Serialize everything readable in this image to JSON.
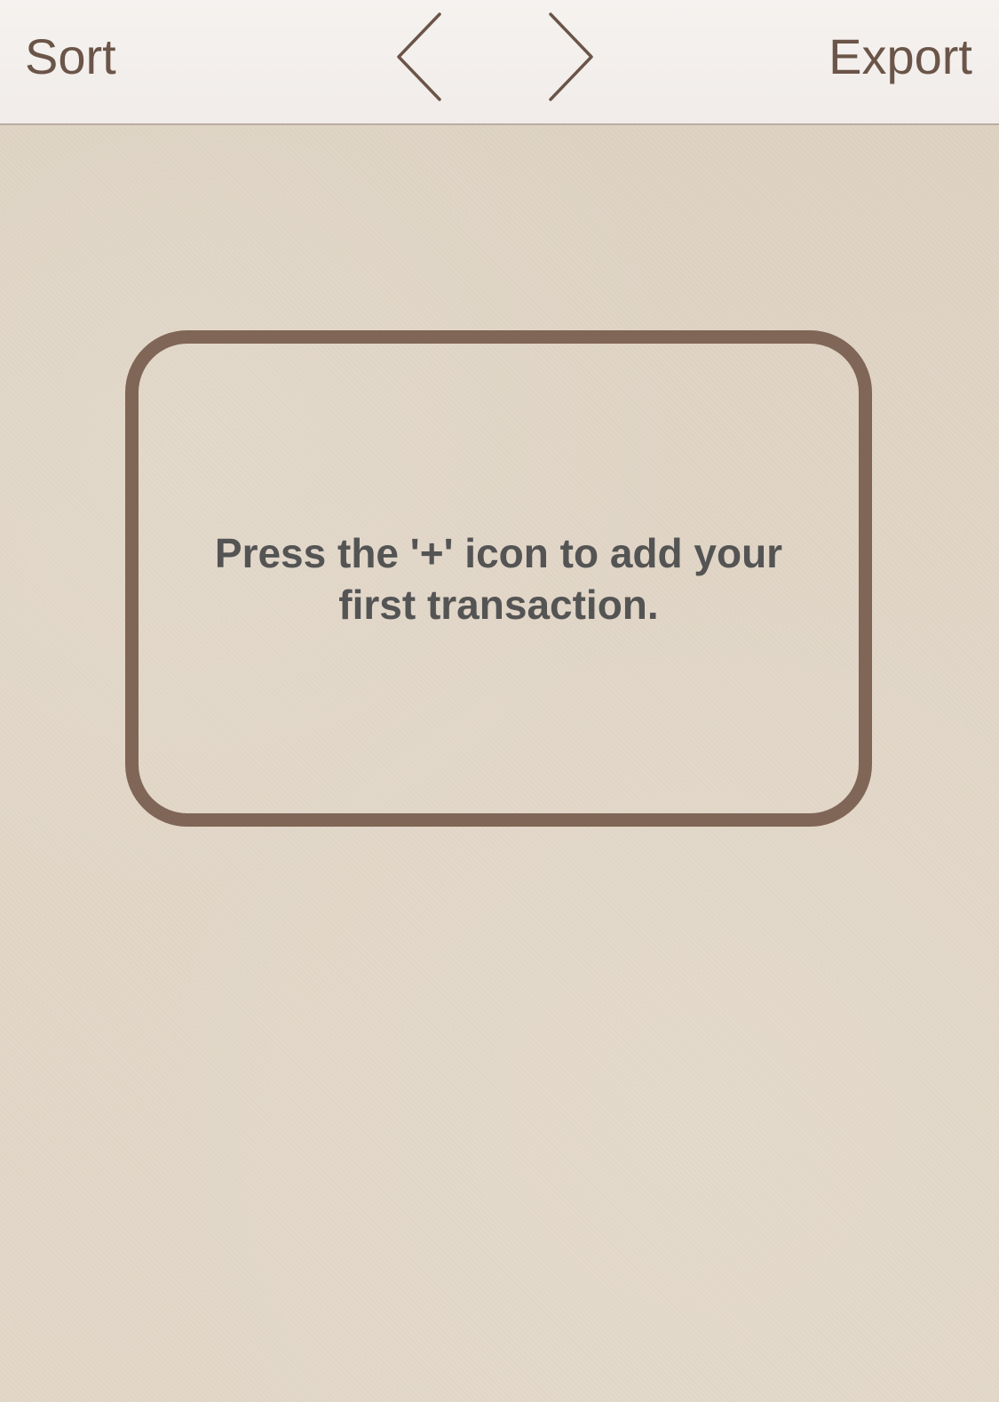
{
  "navbar": {
    "sort_label": "Sort",
    "export_label": "Export",
    "prev_icon": "chevron-left-icon",
    "next_icon": "chevron-right-icon"
  },
  "empty_state": {
    "message": "Press the '+' icon to add your first transaction."
  },
  "colors": {
    "accent": "#6b5548",
    "card_border": "#806656",
    "message_text": "#545454",
    "background": "#e0d5c6",
    "navbar_background": "#f3efec"
  }
}
